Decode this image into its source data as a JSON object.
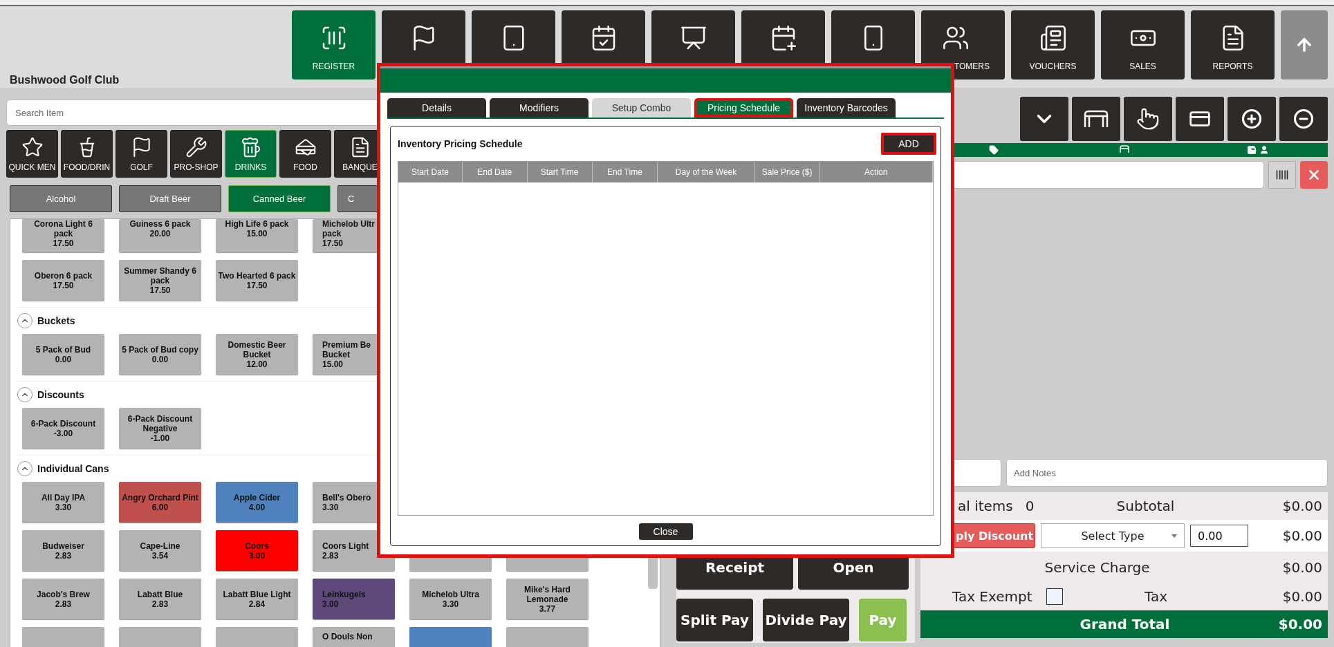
{
  "top_nav": [
    {
      "label": "REGISTER",
      "selected": true,
      "kind": "full"
    },
    {
      "selected": false,
      "kind": "full"
    },
    {
      "selected": false,
      "kind": "full"
    },
    {
      "selected": false,
      "kind": "full"
    },
    {
      "selected": false,
      "kind": "full"
    },
    {
      "selected": false,
      "kind": "full"
    },
    {
      "selected": false,
      "kind": "full"
    },
    {
      "label": "TOMERS",
      "selected": false,
      "kind": "cut"
    },
    {
      "label": "VOUCHERS",
      "selected": false,
      "kind": "full"
    },
    {
      "label": "SALES",
      "selected": false,
      "kind": "full"
    },
    {
      "label": "REPORTS",
      "selected": false,
      "kind": "full"
    }
  ],
  "store_name": "Bushwood Golf Club",
  "search": {
    "placeholder": "Search Item"
  },
  "categories": [
    {
      "label": "QUICK MEN",
      "selected": false
    },
    {
      "label": "FOOD/DRIN",
      "selected": false
    },
    {
      "label": "GOLF",
      "selected": false
    },
    {
      "label": "PRO-SHOP",
      "selected": false
    },
    {
      "label": "DRINKS",
      "selected": true
    },
    {
      "label": "FOOD",
      "selected": false
    },
    {
      "label": "BANQUE",
      "selected": false
    }
  ],
  "subcategories": [
    {
      "label": "Alcohol",
      "selected": false
    },
    {
      "label": "Draft Beer",
      "selected": false
    },
    {
      "label": "Canned Beer",
      "selected": true
    },
    {
      "label": "C",
      "selected": false
    }
  ],
  "item_sections": [
    {
      "rows": [
        [
          {
            "name": "Corona Light 6 pack",
            "price": "17.50",
            "color": "#b3b3b3"
          },
          {
            "name": "Guiness 6 pack",
            "price": "20.00",
            "color": "#b3b3b3"
          },
          {
            "name": "High Life 6 pack",
            "price": "15.00",
            "color": "#b3b3b3"
          },
          {
            "name": "Michelob Ultr pack",
            "price": "17.50",
            "color": "#b3b3b3"
          }
        ],
        [
          {
            "name": "Oberon 6 pack",
            "price": "17.50",
            "color": "#b3b3b3"
          },
          {
            "name": "Summer Shandy 6 pack",
            "price": "17.50",
            "color": "#b3b3b3"
          },
          {
            "name": "Two Hearted 6 pack",
            "price": "17.50",
            "color": "#b3b3b3"
          }
        ]
      ]
    },
    {
      "title": "Buckets",
      "expanded": true,
      "rows": [
        [
          {
            "name": "5 Pack of Bud",
            "price": "0.00",
            "color": "#b3b3b3"
          },
          {
            "name": "5 Pack of Bud copy",
            "price": "0.00",
            "color": "#b3b3b3"
          },
          {
            "name": "Domestic Beer Bucket",
            "price": "12.00",
            "color": "#b3b3b3"
          },
          {
            "name": "Premium Be Bucket",
            "price": "15.00",
            "color": "#b3b3b3"
          }
        ]
      ]
    },
    {
      "title": "Discounts",
      "expanded": true,
      "rows": [
        [
          {
            "name": "6-Pack Discount",
            "price": "-3.00",
            "color": "#b3b3b3"
          },
          {
            "name": "6-Pack Discount Negative",
            "price": "-1.00",
            "color": "#b3b3b3"
          }
        ]
      ]
    },
    {
      "title": "Individual Cans",
      "expanded": true,
      "rows": [
        [
          {
            "name": "All Day IPA",
            "price": "3.30",
            "color": "#b3b3b3"
          },
          {
            "name": "Angry Orchard Pint",
            "price": "6.00",
            "color": "#c0504d"
          },
          {
            "name": "Apple Cider",
            "price": "4.00",
            "color": "#4f81bd"
          },
          {
            "name": "Bell's Obero",
            "price": "3.30",
            "color": "#b3b3b3"
          }
        ],
        [
          {
            "name": "Budweiser",
            "price": "2.83",
            "color": "#b3b3b3"
          },
          {
            "name": "Cape-Line",
            "price": "3.54",
            "color": "#b3b3b3"
          },
          {
            "name": "Coors",
            "price": "3.00",
            "color": "#ff0000"
          },
          {
            "name": "Coors Light",
            "price": "2.83",
            "color": "#b3b3b3"
          },
          {
            "color": "#b3b3b3"
          },
          {
            "color": "#b3b3b3"
          }
        ],
        [
          {
            "name": "Jacob's Brew",
            "price": "2.83",
            "color": "#b3b3b3"
          },
          {
            "name": "Labatt Blue",
            "price": "2.83",
            "color": "#b3b3b3"
          },
          {
            "name": "Labatt Blue Light",
            "price": "2.84",
            "color": "#b3b3b3"
          },
          {
            "name": "Leinkugels",
            "price": "3.00",
            "color": "#5f497a"
          },
          {
            "name": "Michelob Ultra",
            "price": "3.30",
            "color": "#b3b3b3"
          },
          {
            "name": "Mike's Hard Lemonade",
            "price": "3.77",
            "color": "#b3b3b3"
          }
        ],
        [
          {
            "color": "#b3b3b3"
          },
          {
            "color": "#b3b3b3"
          },
          {
            "color": "#b3b3b3"
          },
          {
            "name": "O Douls Non",
            "color": "#b3b3b3"
          },
          {
            "color": "#4f81bd"
          },
          {
            "color": "#b3b3b3"
          }
        ]
      ]
    }
  ],
  "notes": {
    "placeholder": "Add Notes"
  },
  "actions": [
    {
      "label": "Receipt",
      "kind": "dark"
    },
    {
      "label": "Open",
      "kind": "dark"
    },
    {
      "label": "Split Pay",
      "kind": "dark"
    },
    {
      "label": "Divide Pay",
      "kind": "dark"
    },
    {
      "label": "Pay",
      "kind": "pay"
    }
  ],
  "totals": {
    "items_label": "al items",
    "items_count": "0",
    "subtotal_label": "Subtotal",
    "subtotal": "$0.00",
    "discount_button": "ply Discount",
    "discount_type": "Select Type",
    "discount_amount": "0.00",
    "discount": "$0.00",
    "service_charge_label": "Service Charge",
    "service_charge": "$0.00",
    "tax_exempt": {
      "label": "Tax Exempt",
      "checked": false
    },
    "tax_label": "Tax",
    "tax": "$0.00",
    "grand_total_label": "Grand Total",
    "grand_total": "$0.00"
  },
  "dialog": {
    "highlighted": true,
    "tabs": [
      {
        "label": "Details",
        "selected": false,
        "disabled": false,
        "highlighted": false
      },
      {
        "label": "Modifiers",
        "selected": false,
        "disabled": false,
        "highlighted": false
      },
      {
        "label": "Setup Combo",
        "selected": false,
        "disabled": true,
        "highlighted": false
      },
      {
        "label": "Pricing Schedule",
        "selected": true,
        "disabled": false,
        "highlighted": true
      },
      {
        "label": "Inventory Barcodes",
        "selected": false,
        "disabled": false,
        "highlighted": false
      }
    ],
    "panel_title": "Inventory Pricing Schedule",
    "add_button": {
      "label": "ADD",
      "highlighted": true
    },
    "table": {
      "columns": [
        "Start Date",
        "End Date",
        "Start Time",
        "End Time",
        "Day of the Week",
        "Sale Price ($)",
        "Action"
      ]
    },
    "close_button": "Close"
  }
}
